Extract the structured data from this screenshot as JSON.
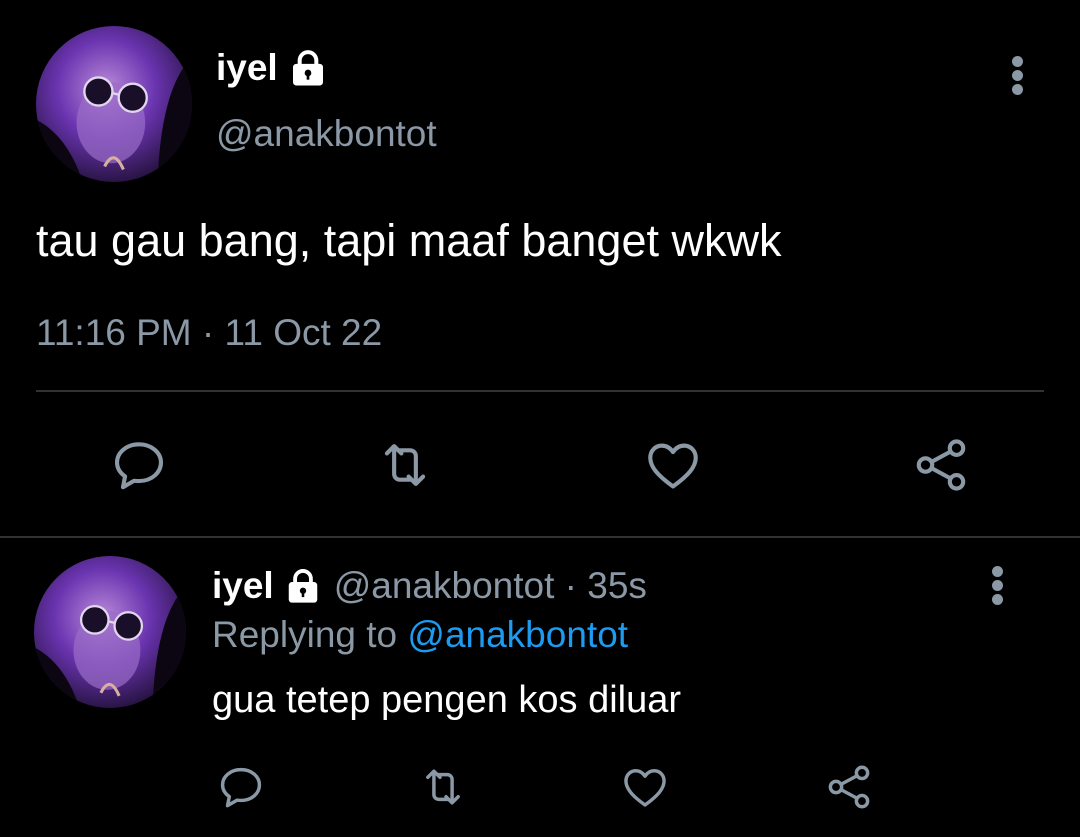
{
  "colors": {
    "background": "#000000",
    "primary_text": "#ffffff",
    "secondary_text": "#8b98a5",
    "divider": "#2f3336",
    "link": "#1d9bf0",
    "avatar_tint": "#5a2a9c"
  },
  "main_tweet": {
    "display_name": "iyel",
    "protected_icon": "lock-icon",
    "handle": "@anakbontot",
    "text": "tau gau bang, tapi maaf banget wkwk",
    "timestamp": "11:16 PM · 11 Oct 22",
    "actions": [
      {
        "name": "reply",
        "icon": "reply-icon"
      },
      {
        "name": "retweet",
        "icon": "retweet-icon"
      },
      {
        "name": "like",
        "icon": "heart-icon"
      },
      {
        "name": "share",
        "icon": "share-icon"
      }
    ]
  },
  "reply_tweet": {
    "display_name": "iyel",
    "protected_icon": "lock-icon",
    "handle_time": "@anakbontot · 35s",
    "replying_prefix": "Replying to ",
    "replying_mention": "@anakbontot",
    "text": "gua tetep pengen kos diluar",
    "actions": [
      {
        "name": "reply",
        "icon": "reply-icon"
      },
      {
        "name": "retweet",
        "icon": "retweet-icon"
      },
      {
        "name": "like",
        "icon": "heart-icon"
      },
      {
        "name": "share",
        "icon": "share-icon"
      }
    ]
  }
}
